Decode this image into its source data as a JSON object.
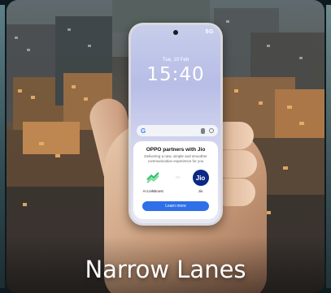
{
  "card": {
    "caption": "Narrow Lanes"
  },
  "phone": {
    "status_signal": "5G",
    "date": "Tue, 10 Feb",
    "time": "15:40",
    "search_logo": "G",
    "panel": {
      "title": "OPPO partners with Jio",
      "subtitle": "Delivering a new, simple and smoother communication experience for you",
      "left_logo_label": "AI LinkBoost",
      "right_logo_text": "Jio",
      "right_logo_label": "Jio",
      "separator": "○○",
      "button_label": "Learn more"
    }
  },
  "colors": {
    "jio_blue": "#0a2885",
    "button_blue": "#2f6fe8",
    "linkboost_green": "#2bc46a"
  },
  "icons": [
    "google-logo-icon",
    "mic-icon",
    "lens-icon",
    "linkboost-icon",
    "jio-logo-icon"
  ]
}
